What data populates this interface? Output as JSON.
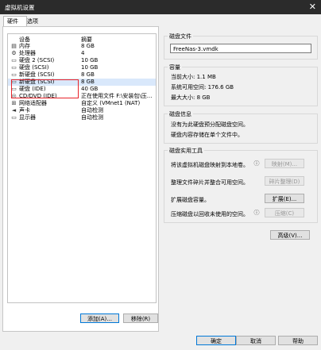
{
  "window": {
    "title": "虚拟机设置",
    "close_glyph": "✕"
  },
  "tabs": [
    {
      "label": "硬件"
    },
    {
      "label": "选项"
    }
  ],
  "device_list": {
    "header": {
      "device": "设备",
      "summary": "摘要"
    },
    "rows": [
      {
        "icon": "memory-icon",
        "glyph": "▤",
        "device": "内存",
        "summary": "8 GB"
      },
      {
        "icon": "processor-icon",
        "glyph": "⚙",
        "device": "处理器",
        "summary": "4"
      },
      {
        "icon": "harddisk-icon",
        "glyph": "▭",
        "device": "硬盘 2 (SCSI)",
        "summary": "10 GB"
      },
      {
        "icon": "harddisk-icon",
        "glyph": "▭",
        "device": "硬盘 (SCSI)",
        "summary": "10 GB"
      },
      {
        "icon": "harddisk-icon",
        "glyph": "▭",
        "device": "新硬盘 (SCSI)",
        "summary": "8 GB"
      },
      {
        "icon": "harddisk-icon",
        "glyph": "▭",
        "device": "新硬盘 (SCSI)",
        "summary": "8 GB"
      },
      {
        "icon": "harddisk-icon",
        "glyph": "▭",
        "device": "硬盘 (IDE)",
        "summary": "40 GB"
      },
      {
        "icon": "cdrom-icon",
        "glyph": "◎",
        "device": "CD/DVD (IDE)",
        "summary": "正在使用文件 F:\\安装包\\压..."
      },
      {
        "icon": "network-icon",
        "glyph": "⊞",
        "device": "网络适配器",
        "summary": "自定义 (VMnet1 (NAT)"
      },
      {
        "icon": "sound-icon",
        "glyph": "◄",
        "device": "声卡",
        "summary": "自动检测"
      },
      {
        "icon": "display-icon",
        "glyph": "▭",
        "device": "显示器",
        "summary": "自动检测"
      }
    ]
  },
  "list_buttons": {
    "add": "添加(A)...",
    "remove": "移除(R)"
  },
  "disk_file": {
    "label": "磁盘文件",
    "value": "FreeNas-3.vmdk"
  },
  "capacity": {
    "label": "容量",
    "current": "当前大小: 1.1 MB",
    "available": "系统可用空间: 176.6 GB",
    "max": "最大大小: 8 GB"
  },
  "disk_info": {
    "label": "磁盘信息",
    "line1": "没有为此硬盘预分配磁盘空间。",
    "line2": "硬盘内容存储在单个文件中。"
  },
  "utilities": {
    "label": "磁盘实用工具",
    "map_text": "将该虚拟机磁盘映射到本地卷。",
    "map_btn": "映射(M)...",
    "defrag_text": "整理文件碎片并整合可用空间。",
    "defrag_btn": "碎片整理(D)",
    "expand_text": "扩展磁盘容量。",
    "expand_btn": "扩展(E)...",
    "compact_text": "压缩磁盘以回收未使用的空间。",
    "compact_btn": "压缩(C)"
  },
  "advanced_btn": "高级(V)...",
  "footer": {
    "ok": "确定",
    "cancel": "取消",
    "help": "帮助"
  }
}
